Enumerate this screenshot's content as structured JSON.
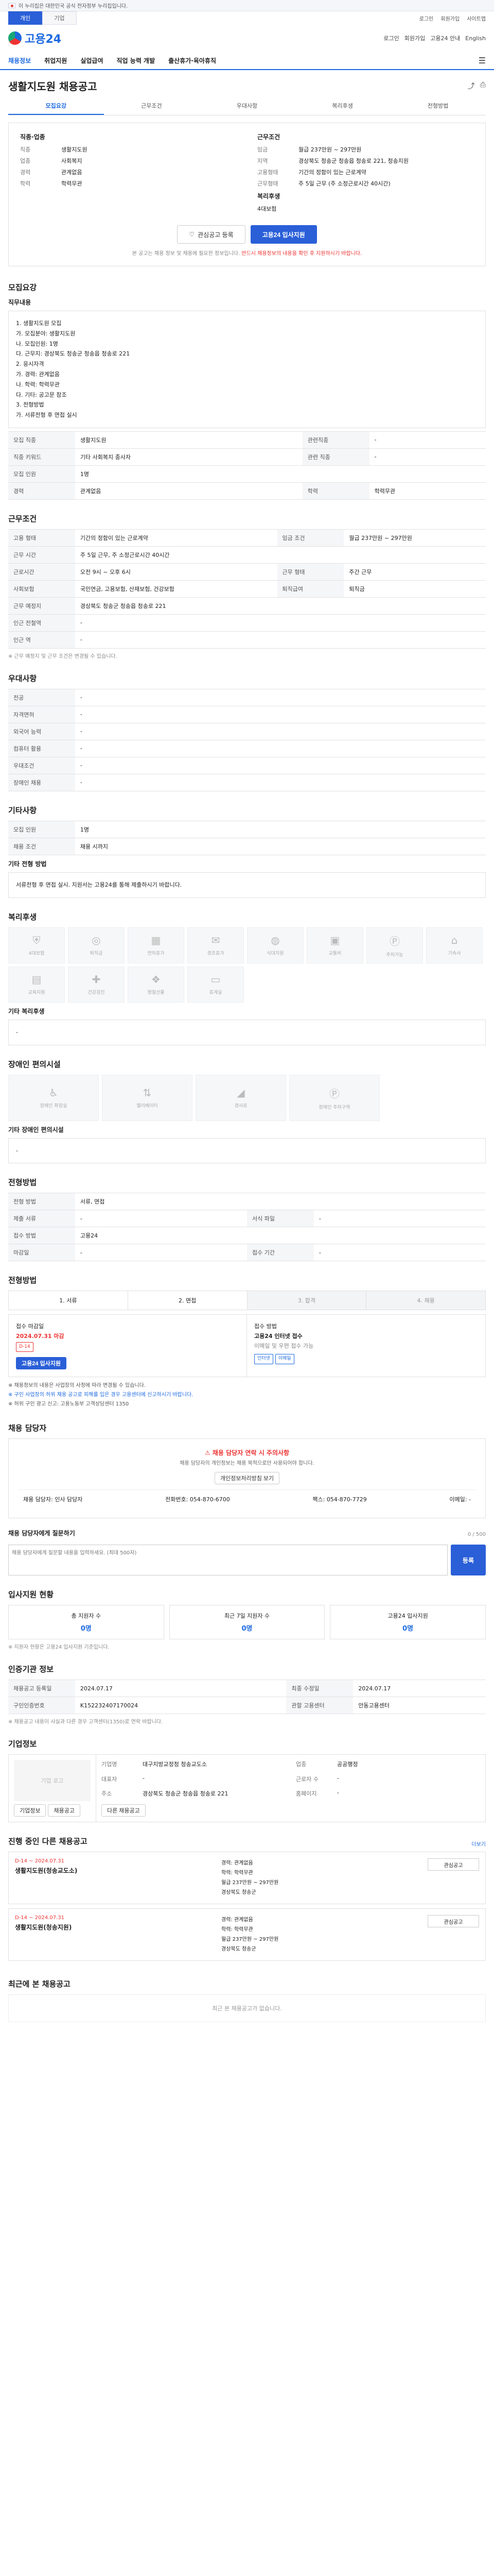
{
  "banner": {
    "text": "이 누리집은 대한민국 공식 전자정부 누리집입니다."
  },
  "utility": {
    "tabs": [
      "개인",
      "기업"
    ],
    "links": [
      "로그인",
      "회원가입",
      "사이트맵"
    ]
  },
  "header": {
    "logo": "고용24",
    "right": [
      "로그인",
      "회원가입",
      "고용24 안내",
      "English"
    ]
  },
  "gnb": {
    "items": [
      "채용정보",
      "취업지원",
      "실업급여",
      "직업 능력 개발",
      "출산휴가·육아휴직"
    ]
  },
  "page": {
    "title": "생활지도원 채용공고"
  },
  "subnav": [
    "모집요강",
    "근무조건",
    "우대사항",
    "복리후생",
    "전형방법"
  ],
  "summary": {
    "left_head": "직종·업종",
    "left": [
      {
        "k": "직종",
        "v": "생활지도원"
      },
      {
        "k": "업종",
        "v": "사회복지"
      },
      {
        "k": "경력",
        "v": "관계없음"
      },
      {
        "k": "학력",
        "v": "학력무관"
      }
    ],
    "right_head": "근무조건",
    "right": [
      {
        "k": "임금",
        "v": "월급 237만원 ~ 297만원"
      },
      {
        "k": "지역",
        "v": "경상북도 청송군 청송읍 청송로 221, 청송지원"
      },
      {
        "k": "고용형태",
        "v": "기간의 정함이 있는 근로계약"
      },
      {
        "k": "근무형태",
        "v": "주 5일 근무 (주 소정근로시간 40시간)"
      }
    ],
    "welfare_head": "복리후생",
    "welfare_v": "4대보험",
    "btn_save": "관심공고 등록",
    "btn_apply": "고용24 입사지원",
    "notice_a": "본 공고는 채용 정보 및 채용에 필요한 정보입니다.",
    "notice_b": "반드시 채용정보의 내용을 확인 후 지원하시기 바랍니다."
  },
  "recruit": {
    "title": "모집요강",
    "duty_head": "직무내용",
    "duty": [
      "1. 생활지도원 모집",
      "가. 모집분야: 생활지도원",
      "나. 모집인원: 1명",
      "다. 근무지: 경상북도 청송군 청송읍 청송로 221",
      "2. 응시자격",
      "가. 경력: 관계없음",
      "나. 학력: 학력무관",
      "다. 기타: 공고문 참조",
      "3. 전형방법",
      "가. 서류전형 후 면접 실시"
    ],
    "rows": [
      {
        "k": "모집 직종",
        "v": "생활지도원",
        "k2": "관련직종",
        "v2": "-"
      },
      {
        "k": "직종 키워드",
        "v": "기타 사회복지 종사자",
        "k2": "관련 직종",
        "v2": "-"
      },
      {
        "k": "모집 인원",
        "v": "1명",
        "k2": "",
        "v2": ""
      },
      {
        "k": "경력",
        "v": "관계없음",
        "k2": "학력",
        "v2": "학력무관"
      }
    ]
  },
  "work": {
    "title": "근무조건",
    "rows": [
      {
        "k": "고용 형태",
        "v": "기간의 정함이 있는 근로계약",
        "k2": "임금 조건",
        "v2": "월급 237만원 ~ 297만원"
      },
      {
        "k": "근무 시간",
        "v": "주 5일 근무, 주 소정근로시간 40시간",
        "k2": "",
        "v2": ""
      },
      {
        "k": "근로시간",
        "v": "오전 9시 ~ 오후 6시",
        "k2": "근무 형태",
        "v2": "주간 근무"
      },
      {
        "k": "사회보험",
        "v": "국민연금, 고용보험, 산재보험, 건강보험",
        "k2": "퇴직급여",
        "v2": "퇴직금"
      },
      {
        "k": "근무 예정지",
        "v": "경상북도 청송군 청송읍 청송로 221",
        "k2": "",
        "v2": ""
      },
      {
        "k": "인근 전철역",
        "v": "-",
        "k2": "",
        "v2": ""
      },
      {
        "k": "인근 역",
        "v": "-",
        "k2": "",
        "v2": ""
      }
    ],
    "note": "※ 근무 예정지 및 근무 조건은 변경될 수 있습니다."
  },
  "prefer": {
    "title": "우대사항",
    "rows": [
      {
        "k": "전공",
        "v": "-"
      },
      {
        "k": "자격면허",
        "v": "-"
      },
      {
        "k": "외국어 능력",
        "v": "-"
      },
      {
        "k": "컴퓨터 활용",
        "v": "-"
      },
      {
        "k": "우대조건",
        "v": "-"
      },
      {
        "k": "장애인 채용",
        "v": "-"
      }
    ]
  },
  "other": {
    "title": "기타사항",
    "rows": [
      {
        "k": "모집 인원",
        "v": "1명"
      },
      {
        "k": "채용 조건",
        "v": "채용 시까지"
      }
    ],
    "memo_head": "기타 전형 방법",
    "memo": "서류전형 후 면접 실시. 지원서는 고용24를 통해 제출하시기 바랍니다."
  },
  "welfare": {
    "title": "복리후생",
    "cards": [
      "4대보험",
      "퇴직금",
      "연차휴가",
      "경조휴가",
      "식대지원",
      "교통비",
      "주차가능",
      "기숙사",
      "교육지원",
      "건강검진",
      "명절선물",
      "휴게실"
    ],
    "extra_head": "기타 복리후생",
    "extra": "-"
  },
  "facility": {
    "title": "장애인 편의시설",
    "cards": [
      "장애인 화장실",
      "엘리베이터",
      "경사로",
      "장애인 주차구역"
    ],
    "note_head": "기타 장애인 편의시설",
    "note": "-"
  },
  "selection": {
    "title": "전형방법",
    "rows": [
      {
        "k": "전형 방법",
        "v": "서류, 면접",
        "k2": "",
        "v2": ""
      },
      {
        "k": "제출 서류",
        "v": "-",
        "k2": "서식 파일",
        "v2": "-"
      },
      {
        "k": "접수 방법",
        "v": "고용24",
        "k2": "",
        "v2": ""
      },
      {
        "k": "마감일",
        "v": "-",
        "k2": "접수 기간",
        "v2": "-"
      }
    ]
  },
  "apply": {
    "title": "전형방법",
    "steps": [
      "1. 서류",
      "2. 면접",
      "3. 합격",
      "4. 채용"
    ],
    "deadline_label": "접수 마감일",
    "deadline": "2024.07.31 마감",
    "deadline_tag": "D-14",
    "btn": "고용24 입사지원",
    "method_label": "접수 방법",
    "method": "고용24 인터넷 접수",
    "method_sub": "이메일 및 우편 접수 가능",
    "tag_a": "인터넷",
    "tag_b": "이메일",
    "bullets": [
      "※ 채용정보의 내용은 사업장의 사정에 따라 변경될 수 있습니다.",
      "※ 구인 사업장의 허위 채용 공고로 피해를 입은 경우 고용센터에 신고하시기 바랍니다.",
      "※ 허위 구인 광고 신고: 고용노동부 고객상담센터 1350"
    ]
  },
  "contact": {
    "title": "채용 담당자",
    "warn": "채용 담당자 연락 시 주의사항",
    "desc": "채용 담당자의 개인정보는 채용 목적으로만 사용되어야 합니다.",
    "btn": "개인정보처리방침 보기",
    "name_label": "채용 담당자",
    "name": "인사 담당자",
    "phone_label": "전화번호",
    "phone": "054-870-6700",
    "fax_label": "팩스",
    "fax": "054-870-7729",
    "email_label": "이메일",
    "email": "-",
    "inquiry_head": "채용 담당자에게 질문하기",
    "inquiry_ph": "채용 담당자에게 질문할 내용을 입력하세요. (최대 500자)",
    "inquiry_btn": "등록",
    "inquiry_count": "0 / 500"
  },
  "stats": {
    "title": "입사지원 현황",
    "cards": [
      {
        "k": "총 지원자 수",
        "v": "0명"
      },
      {
        "k": "최근 7일 지원자 수",
        "v": "0명"
      },
      {
        "k": "고용24 입사지원",
        "v": "0명"
      }
    ],
    "note": "※ 지원자 현황은 고용24 입사지원 기준입니다."
  },
  "posting": {
    "title": "인증기관 정보",
    "rows": [
      {
        "k": "채용공고 등록일",
        "v": "2024.07.17",
        "k2": "최종 수정일",
        "v2": "2024.07.17"
      },
      {
        "k": "구인인증번호",
        "v": "K152232407170024",
        "k2": "관할 고용센터",
        "v2": "안동고용센터"
      }
    ],
    "note": "※ 채용공고 내용이 사실과 다른 경우 고객센터(1350)로 연락 바랍니다."
  },
  "company": {
    "title": "기업정보",
    "logo_ph": "기업 로고",
    "btns": [
      "기업정보",
      "채용공고"
    ],
    "fields": [
      {
        "k": "기업명",
        "v": "대구지방교정청 청송교도소"
      },
      {
        "k": "업종",
        "v": "공공행정"
      },
      {
        "k": "대표자",
        "v": "-"
      },
      {
        "k": "근로자 수",
        "v": "-"
      },
      {
        "k": "주소",
        "v": "경상북도 청송군 청송읍 청송로 221"
      },
      {
        "k": "홈페이지",
        "v": "-"
      }
    ],
    "btn_more": "다른 채용공고"
  },
  "similar": {
    "title": "진행 중인 다른 채용공고",
    "link": "더보기",
    "items": [
      {
        "dl": "D-14",
        "date": "~ 2024.07.31",
        "title": "생활지도원(청송교도소)",
        "cond": [
          "경력: 관계없음",
          "학력: 학력무관",
          "월급 237만원 ~ 297만원",
          "경상북도 청송군"
        ],
        "btn": "관심공고"
      },
      {
        "dl": "D-14",
        "date": "~ 2024.07.31",
        "title": "생활지도원(청송지원)",
        "cond": [
          "경력: 관계없음",
          "학력: 학력무관",
          "월급 237만원 ~ 297만원",
          "경상북도 청송군"
        ],
        "btn": "관심공고"
      }
    ]
  },
  "recent": {
    "title": "최근에 본 채용공고",
    "empty": "최근 본 채용공고가 없습니다."
  }
}
